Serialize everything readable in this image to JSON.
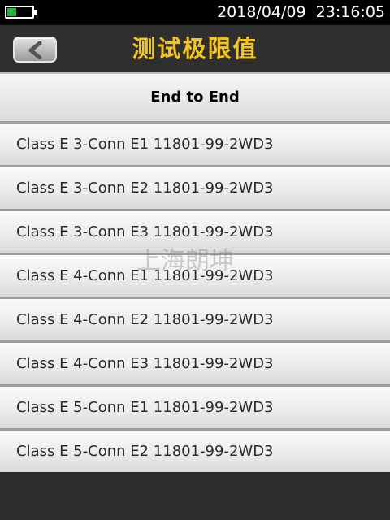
{
  "status_bar": {
    "datetime": "2018/04/09  23:16:05",
    "battery_level": 0.35,
    "battery_color": "#1fb53c"
  },
  "title_bar": {
    "title": "测试极限值",
    "title_color": "#f5c518"
  },
  "list_header": {
    "label": "End to End"
  },
  "limits": [
    {
      "label": "Class E 3-Conn E1 11801-99-2WD3"
    },
    {
      "label": "Class E 3-Conn E2 11801-99-2WD3"
    },
    {
      "label": "Class E 3-Conn E3 11801-99-2WD3"
    },
    {
      "label": "Class E 4-Conn E1 11801-99-2WD3"
    },
    {
      "label": "Class E 4-Conn E2 11801-99-2WD3"
    },
    {
      "label": "Class E 4-Conn E3 11801-99-2WD3"
    },
    {
      "label": "Class E 5-Conn E1 11801-99-2WD3"
    },
    {
      "label": "Class E 5-Conn E2 11801-99-2WD3"
    }
  ],
  "watermark": {
    "text": "上海朗坤"
  }
}
